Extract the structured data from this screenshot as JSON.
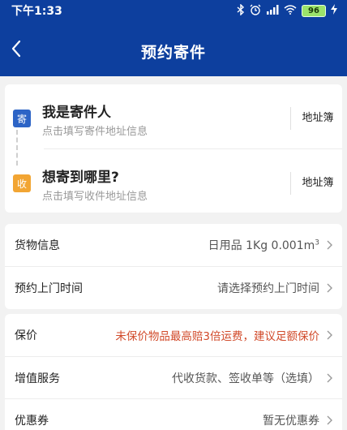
{
  "status_bar": {
    "time": "下午1:33",
    "icons": [
      "bluetooth-icon",
      "alarm-icon",
      "signal-icon",
      "wifi-icon",
      "battery-icon",
      "charging-icon"
    ],
    "battery": "96"
  },
  "header": {
    "title": "预约寄件",
    "back_icon": "chevron-left-icon",
    "background": "#0d3f9e"
  },
  "sender": {
    "tag": "寄",
    "title": "我是寄件人",
    "hint": "点击填写寄件地址信息",
    "address_book": "地址簿",
    "tag_color": "#2d64c6"
  },
  "receiver": {
    "tag": "收",
    "title": "想寄到哪里?",
    "hint": "点击填写收件地址信息",
    "address_book": "地址簿",
    "tag_color": "#f2a533"
  },
  "goods": {
    "label": "货物信息",
    "value": "日用品 1Kg 0.001m",
    "unit_sup": "3"
  },
  "pickup_time": {
    "label": "预约上门时间",
    "value": "请选择预约上门时间"
  },
  "insurance": {
    "label": "保价",
    "value": "未保价物品最高赔3倍运费，建议足额保价",
    "value_color": "#d14a2a"
  },
  "value_added": {
    "label": "增值服务",
    "value": "代收货款、签收单等（选填）"
  },
  "coupon": {
    "label": "优惠券",
    "value": "暂无优惠券"
  }
}
